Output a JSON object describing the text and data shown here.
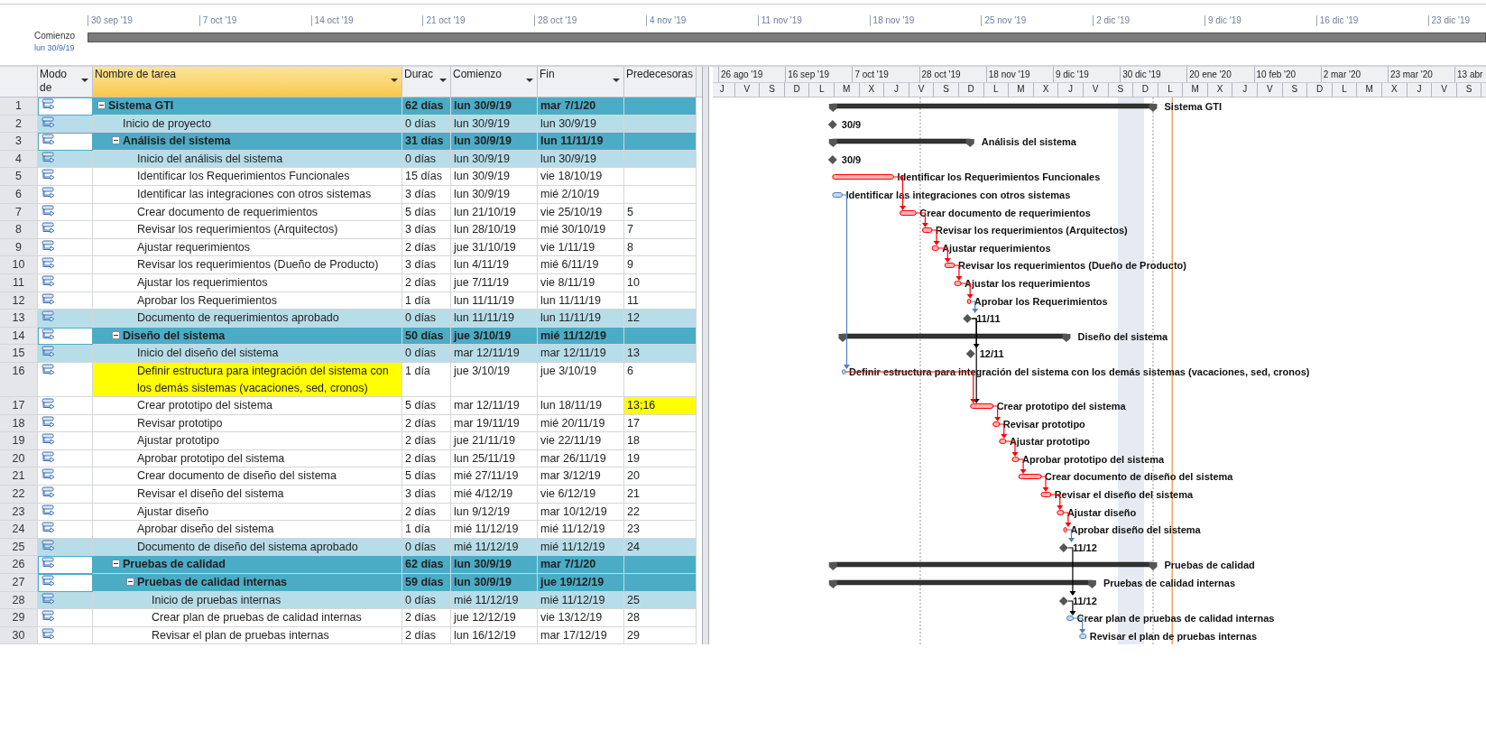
{
  "timeline": {
    "start_label": "Comienzo",
    "start_date": "lun 30/9/19",
    "ticks": [
      "30 sep '19",
      "7 oct '19",
      "14 oct '19",
      "21 oct '19",
      "28 oct '19",
      "4 nov '19",
      "11 nov '19",
      "18 nov '19",
      "25 nov '19",
      "2 dic '19",
      "9 dic '19",
      "16 dic '19",
      "23 dic '19"
    ]
  },
  "table": {
    "columns": [
      {
        "label": "Modo de",
        "menu": true,
        "selected": false
      },
      {
        "label": "Nombre de tarea",
        "menu": true,
        "selected": true
      },
      {
        "label": "Durac",
        "menu": true,
        "selected": false
      },
      {
        "label": "Comienzo",
        "menu": true,
        "selected": false
      },
      {
        "label": "Fin",
        "menu": true,
        "selected": false
      },
      {
        "label": "Predecesoras",
        "menu": false,
        "selected": false
      }
    ],
    "rows": [
      {
        "id": "1",
        "kind": "summary",
        "expanded": true,
        "name": "Sistema GTI",
        "duration": "62 días",
        "start": "lun 30/9/19",
        "finish": "mar 7/1/20",
        "bar_label": "Sistema GTI",
        "children": [
          {
            "id": "2",
            "kind": "milestone",
            "name": "Inicio de proyecto",
            "duration": "0 días",
            "start": "lun 30/9/19",
            "finish": "lun 30/9/19",
            "bar_label": "30/9"
          },
          {
            "id": "3",
            "kind": "summary",
            "expanded": true,
            "name": "Análisis del sistema",
            "duration": "31 días",
            "start": "lun 30/9/19",
            "finish": "lun 11/11/19",
            "bar_label": "Análisis del sistema",
            "children": [
              {
                "id": "4",
                "kind": "milestone",
                "name": "Inicio del análisis del sistema",
                "duration": "0 días",
                "start": "lun 30/9/19",
                "finish": "lun 30/9/19",
                "bar_label": "30/9"
              },
              {
                "id": "5",
                "kind": "task",
                "critical": true,
                "name": "Identificar los Requerimientos Funcionales",
                "duration": "15 días",
                "start": "lun 30/9/19",
                "finish": "vie 18/10/19",
                "bar_label": "Identificar los Requerimientos Funcionales"
              },
              {
                "id": "6",
                "kind": "task",
                "critical": false,
                "name": "Identificar las integraciones con otros sistemas",
                "duration": "3 días",
                "start": "lun 30/9/19",
                "finish": "mié 2/10/19",
                "bar_label": "Identificar las integraciones con otros sistemas"
              },
              {
                "id": "7",
                "kind": "task",
                "critical": true,
                "name": "Crear documento de requerimientos",
                "duration": "5 días",
                "start": "lun 21/10/19",
                "finish": "vie 25/10/19",
                "predecessors": "5",
                "bar_label": "Crear documento de requerimientos"
              },
              {
                "id": "8",
                "kind": "task",
                "critical": true,
                "name": "Revisar los requerimientos (Arquitectos)",
                "duration": "3 días",
                "start": "lun 28/10/19",
                "finish": "mié 30/10/19",
                "predecessors": "7",
                "bar_label": "Revisar los requerimientos (Arquitectos)"
              },
              {
                "id": "9",
                "kind": "task",
                "critical": true,
                "name": "Ajustar requerimientos",
                "duration": "2 días",
                "start": "jue 31/10/19",
                "finish": "vie 1/11/19",
                "predecessors": "8",
                "bar_label": "Ajustar requerimientos"
              },
              {
                "id": "10",
                "kind": "task",
                "critical": true,
                "name": "Revisar los requerimientos (Dueño de Producto)",
                "duration": "3 días",
                "start": "lun 4/11/19",
                "finish": "mié 6/11/19",
                "predecessors": "9",
                "bar_label": "Revisar los requerimientos (Dueño de Producto)"
              },
              {
                "id": "11",
                "kind": "task",
                "critical": true,
                "name": "Ajustar los requerimientos",
                "duration": "2 días",
                "start": "jue 7/11/19",
                "finish": "vie 8/11/19",
                "predecessors": "10",
                "bar_label": "Ajustar los requerimientos"
              },
              {
                "id": "12",
                "kind": "task",
                "critical": true,
                "name": "Aprobar los Requerimientos",
                "duration": "1 día",
                "start": "lun 11/11/19",
                "finish": "lun 11/11/19",
                "predecessors": "11",
                "bar_label": "Aprobar los Requerimientos"
              },
              {
                "id": "13",
                "kind": "milestone",
                "name": "Documento de requerimientos aprobado",
                "duration": "0 días",
                "start": "lun 11/11/19",
                "finish": "lun 11/11/19",
                "predecessors": "12",
                "bar_label": "11/11"
              }
            ]
          },
          {
            "id": "14",
            "kind": "summary",
            "expanded": true,
            "name": "Diseño del sistema",
            "duration": "50 días",
            "start": "jue 3/10/19",
            "finish": "mié 11/12/19",
            "bar_label": "Diseño del sistema",
            "children": [
              {
                "id": "15",
                "kind": "milestone",
                "name": "Inicio del diseño del sistema",
                "duration": "0 días",
                "start": "mar 12/11/19",
                "finish": "mar 12/11/19",
                "predecessors": "13",
                "bar_label": "12/11"
              },
              {
                "id": "16",
                "kind": "task",
                "critical": false,
                "highlighted": true,
                "name": "Definir estructura para integración del sistema con los demás sistemas (vacaciones, sed, cronos)",
                "duration": "1 día",
                "start": "jue 3/10/19",
                "finish": "jue 3/10/19",
                "predecessors": "6",
                "bar_label": "Definir estructura para integración del sistema con los demás sistemas (vacaciones, sed, cronos)"
              },
              {
                "id": "17",
                "kind": "task",
                "critical": true,
                "name": "Crear prototipo del sistema",
                "duration": "5 días",
                "start": "mar 12/11/19",
                "finish": "lun 18/11/19",
                "predecessors": "13;16",
                "predecessors_highlighted": true,
                "bar_label": "Crear prototipo del sistema"
              },
              {
                "id": "18",
                "kind": "task",
                "critical": true,
                "name": "Revisar prototipo",
                "duration": "2 días",
                "start": "mar 19/11/19",
                "finish": "mié 20/11/19",
                "predecessors": "17",
                "bar_label": "Revisar prototipo"
              },
              {
                "id": "19",
                "kind": "task",
                "critical": true,
                "name": "Ajustar prototipo",
                "duration": "2 días",
                "start": "jue 21/11/19",
                "finish": "vie 22/11/19",
                "predecessors": "18",
                "bar_label": "Ajustar prototipo"
              },
              {
                "id": "20",
                "kind": "task",
                "critical": true,
                "name": "Aprobar prototipo del sistema",
                "duration": "2 días",
                "start": "lun 25/11/19",
                "finish": "mar 26/11/19",
                "predecessors": "19",
                "bar_label": "Aprobar prototipo del sistema"
              },
              {
                "id": "21",
                "kind": "task",
                "critical": true,
                "name": "Crear documento de diseño del sistema",
                "duration": "5 días",
                "start": "mié 27/11/19",
                "finish": "mar 3/12/19",
                "predecessors": "20",
                "bar_label": "Crear documento de diseño del sistema"
              },
              {
                "id": "22",
                "kind": "task",
                "critical": true,
                "name": "Revisar el diseño del sistema",
                "duration": "3 días",
                "start": "mié 4/12/19",
                "finish": "vie 6/12/19",
                "predecessors": "21",
                "bar_label": "Revisar el diseño del sistema"
              },
              {
                "id": "23",
                "kind": "task",
                "critical": true,
                "name": "Ajustar diseño",
                "duration": "2 días",
                "start": "lun 9/12/19",
                "finish": "mar 10/12/19",
                "predecessors": "22",
                "bar_label": "Ajustar diseño"
              },
              {
                "id": "24",
                "kind": "task",
                "critical": true,
                "name": "Aprobar diseño del sistema",
                "duration": "1 día",
                "start": "mié 11/12/19",
                "finish": "mié 11/12/19",
                "predecessors": "23",
                "bar_label": "Aprobar diseño del sistema"
              },
              {
                "id": "25",
                "kind": "milestone",
                "name": "Documento de diseño del sistema aprobado",
                "duration": "0 días",
                "start": "mié 11/12/19",
                "finish": "mié 11/12/19",
                "predecessors": "24",
                "bar_label": "11/12"
              }
            ]
          },
          {
            "id": "26",
            "kind": "summary",
            "expanded": true,
            "name": "Pruebas de calidad",
            "duration": "62 días",
            "start": "lun 30/9/19",
            "finish": "mar 7/1/20",
            "bar_label": "Pruebas de calidad",
            "children": [
              {
                "id": "27",
                "kind": "summary",
                "expanded": true,
                "name": "Pruebas de calidad internas",
                "duration": "59 días",
                "start": "lun 30/9/19",
                "finish": "jue 19/12/19",
                "bar_label": "Pruebas de calidad internas",
                "children": [
                  {
                    "id": "28",
                    "kind": "milestone",
                    "name": "Inicio de pruebas internas",
                    "duration": "0 días",
                    "start": "mié 11/12/19",
                    "finish": "mié 11/12/19",
                    "predecessors": "25",
                    "bar_label": "11/12"
                  },
                  {
                    "id": "29",
                    "kind": "task",
                    "critical": false,
                    "name": "Crear plan de pruebas de calidad internas",
                    "duration": "2 días",
                    "start": "jue 12/12/19",
                    "finish": "vie 13/12/19",
                    "predecessors": "28",
                    "bar_label": "Crear plan de pruebas de calidad internas"
                  },
                  {
                    "id": "30",
                    "kind": "task",
                    "critical": false,
                    "name": "Revisar el plan de pruebas internas",
                    "duration": "2 días",
                    "start": "lun 16/12/19",
                    "finish": "mar 17/12/19",
                    "predecessors": "29",
                    "bar_label": "Revisar el plan de pruebas internas"
                  }
                ]
              }
            ]
          }
        ]
      }
    ]
  },
  "gantt": {
    "top_tier": [
      "26 ago '19",
      "16 sep '19",
      "7 oct '19",
      "28 oct '19",
      "18 nov '19",
      "9 dic '19",
      "30 dic '19",
      "20 ene '20",
      "10 feb '20",
      "2 mar '20",
      "23 mar '20",
      "13 abr"
    ],
    "bottom_tier": [
      "J",
      "V",
      "S",
      "D",
      "L",
      "M",
      "X",
      "J",
      "V",
      "S",
      "D",
      "L",
      "M",
      "X",
      "J",
      "V",
      "S",
      "D",
      "L",
      "M",
      "X",
      "J",
      "V",
      "S",
      "D",
      "L",
      "M",
      "X",
      "J",
      "V",
      "S"
    ]
  }
}
